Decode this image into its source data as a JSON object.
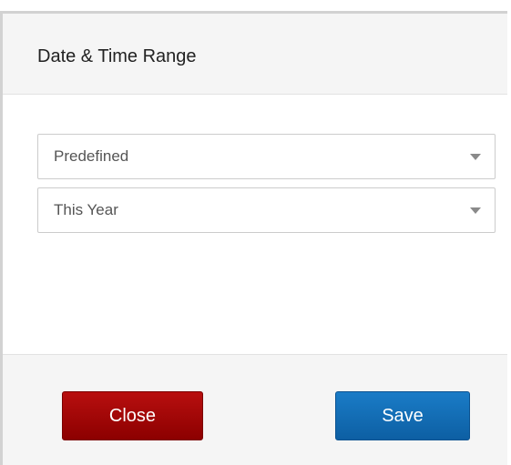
{
  "dialog": {
    "title": "Date & Time Range",
    "range_type_select": {
      "value": "Predefined"
    },
    "range_select": {
      "value": "This Year"
    },
    "buttons": {
      "close_label": "Close",
      "save_label": "Save"
    }
  },
  "colors": {
    "close_button": "#a00000",
    "save_button": "#1570b8",
    "header_background": "#f5f5f5"
  },
  "icons": {
    "dropdown_arrow": "caret-down-icon"
  }
}
